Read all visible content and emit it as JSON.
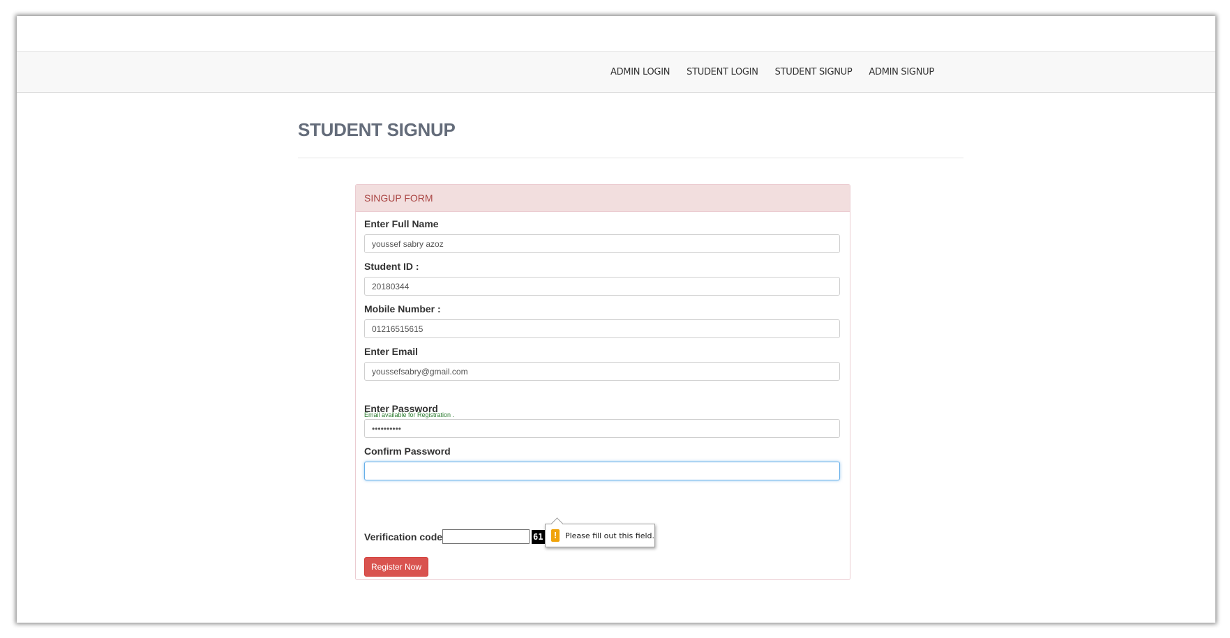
{
  "nav": {
    "items": [
      {
        "label": "ADMIN LOGIN"
      },
      {
        "label": "STUDENT LOGIN"
      },
      {
        "label": "STUDENT SIGNUP"
      },
      {
        "label": "ADMIN SIGNUP"
      }
    ]
  },
  "page": {
    "title": "STUDENT SIGNUP"
  },
  "form": {
    "heading": "SINGUP FORM",
    "full_name": {
      "label": "Enter Full Name",
      "value": "youssef sabry azoz"
    },
    "student_id": {
      "label": "Student ID :",
      "value": "20180344"
    },
    "mobile": {
      "label": "Mobile Number :",
      "value": "01216515615"
    },
    "email": {
      "label": "Enter Email",
      "value": "youssefsabry@gmail.com",
      "help": "Email available for Registration ."
    },
    "password": {
      "label": "Enter Password",
      "value": "••••••••••"
    },
    "confirm_password": {
      "label": "Confirm Password",
      "value": ""
    },
    "verification": {
      "label": "Verification code :",
      "value": "",
      "captcha": "61"
    },
    "validation_message": "Please fill out this field.",
    "submit_label": "Register Now"
  },
  "colors": {
    "heading_bg": "#f2dede",
    "heading_text": "#a94442",
    "button": "#d9534f",
    "help_text": "#2e7d32",
    "warning_icon": "#f0a30a"
  },
  "icons": {
    "validation": "warning-icon"
  }
}
